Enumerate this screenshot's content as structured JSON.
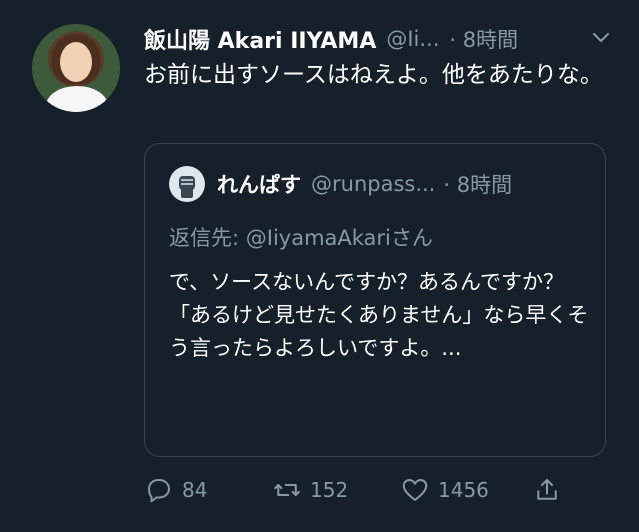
{
  "tweet": {
    "display_name": "飯山陽 Akari IIYAMA",
    "handle": "@Ii...",
    "time": "· 8時間",
    "text": "お前に出すソースはねえよ。他をあたりな。"
  },
  "quoted_tweet": {
    "display_name": "れんぱす",
    "handle": "@runpass...",
    "time": "· 8時間",
    "reply_to": "返信先: @IiyamaAkariさん",
    "text": "で、ソースないんですか？あるんですか？\n「あるけど見せたくありません」なら早くそう言ったらよろしいですよ。..."
  },
  "actions": {
    "reply_count": "84",
    "retweet_count": "152",
    "like_count": "1456"
  },
  "icons": {
    "chevron": "chevron-down-icon",
    "reply": "reply-icon",
    "retweet": "retweet-icon",
    "like": "heart-icon",
    "share": "share-icon"
  },
  "colors": {
    "background": "#15202b",
    "secondary_text": "#8899a6",
    "border": "#38444d"
  }
}
